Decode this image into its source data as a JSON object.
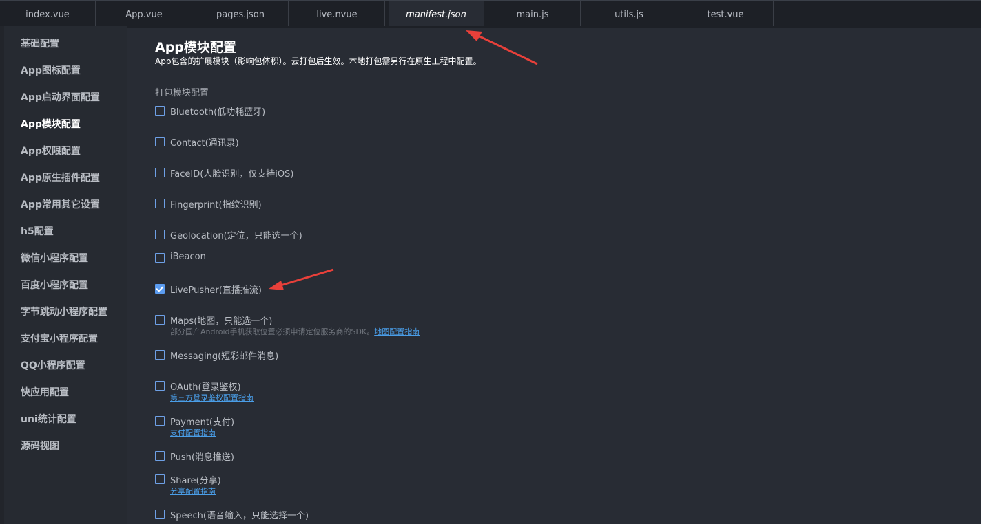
{
  "tabs": [
    {
      "label": "index.vue",
      "active": false
    },
    {
      "label": "App.vue",
      "active": false
    },
    {
      "label": "pages.json",
      "active": false
    },
    {
      "label": "live.nvue",
      "active": false
    },
    {
      "label": "manifest.json",
      "active": true
    },
    {
      "label": "main.js",
      "active": false
    },
    {
      "label": "utils.js",
      "active": false
    },
    {
      "label": "test.vue",
      "active": false
    }
  ],
  "sidebar": {
    "items": [
      {
        "label": "基础配置"
      },
      {
        "label": "App图标配置"
      },
      {
        "label": "App启动界面配置"
      },
      {
        "label": "App模块配置",
        "active": true
      },
      {
        "label": "App权限配置"
      },
      {
        "label": "App原生插件配置"
      },
      {
        "label": "App常用其它设置"
      },
      {
        "label": "h5配置"
      },
      {
        "label": "微信小程序配置"
      },
      {
        "label": "百度小程序配置"
      },
      {
        "label": "字节跳动小程序配置"
      },
      {
        "label": "支付宝小程序配置"
      },
      {
        "label": "QQ小程序配置"
      },
      {
        "label": "快应用配置"
      },
      {
        "label": "uni统计配置"
      },
      {
        "label": "源码视图"
      }
    ]
  },
  "main": {
    "title": "App模块配置",
    "description": "App包含的扩展模块（影响包体积）。云打包后生效。本地打包需另行在原生工程中配置。",
    "section_title": "打包模块配置",
    "modules": [
      {
        "label": "Bluetooth(低功耗蓝牙)",
        "checked": false
      },
      {
        "label": "Contact(通讯录)",
        "checked": false
      },
      {
        "label": "FaceID(人脸识别，仅支持iOS)",
        "checked": false
      },
      {
        "label": "Fingerprint(指纹识别)",
        "checked": false
      },
      {
        "label": "Geolocation(定位，只能选一个)",
        "checked": false
      },
      {
        "label": "iBeacon",
        "checked": false
      },
      {
        "label": "LivePusher(直播推流)",
        "checked": true
      },
      {
        "label": "Maps(地图，只能选一个)",
        "checked": false,
        "note": "部分国产Android手机获取位置必须申请定位服务商的SDK。",
        "link": "地图配置指南"
      },
      {
        "label": "Messaging(短彩邮件消息)",
        "checked": false
      },
      {
        "label": "OAuth(登录鉴权)",
        "checked": false,
        "link": "第三方登录鉴权配置指南"
      },
      {
        "label": "Payment(支付)",
        "checked": false,
        "link": "支付配置指南"
      },
      {
        "label": "Push(消息推送)",
        "checked": false
      },
      {
        "label": "Share(分享)",
        "checked": false,
        "link": "分享配置指南"
      },
      {
        "label": "Speech(语音输入，只能选择一个)",
        "checked": false
      }
    ]
  },
  "colors": {
    "background": "#282c34",
    "accent": "#5b9cf0",
    "link": "#4a9ee8",
    "annotation_arrow": "#e8403a"
  }
}
